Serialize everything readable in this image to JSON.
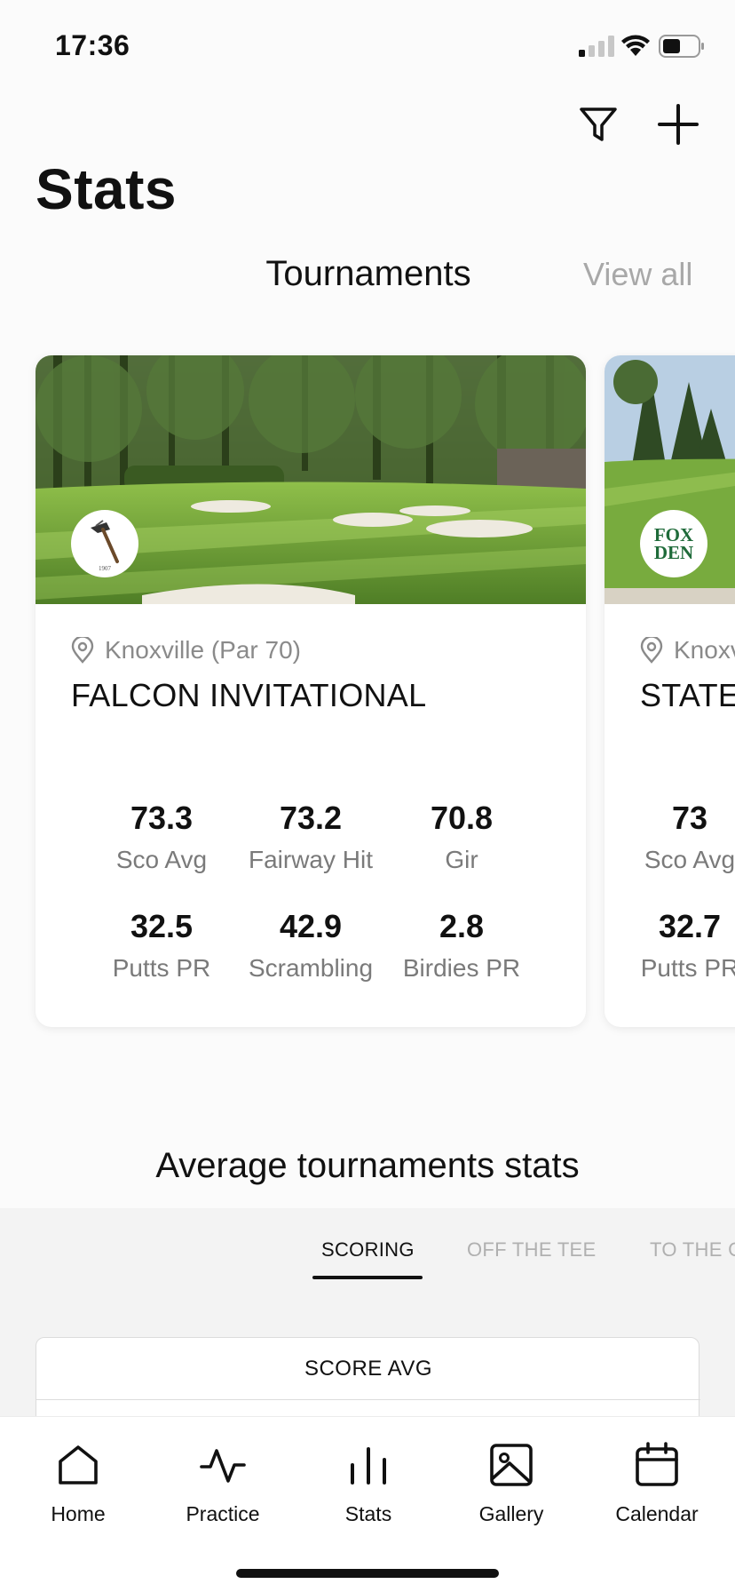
{
  "status_bar": {
    "time": "17:36"
  },
  "header": {
    "title": "Stats",
    "filter_icon": "filter-icon",
    "add_icon": "plus-icon"
  },
  "tournaments": {
    "section_title": "Tournaments",
    "view_all": "View all",
    "cards": [
      {
        "location": "Knoxville (Par 70)",
        "name": "FALCON INVITATIONAL",
        "stats": [
          {
            "value": "73.3",
            "label": "Sco Avg"
          },
          {
            "value": "73.2",
            "label": "Fairway Hit"
          },
          {
            "value": "70.8",
            "label": "Gir"
          },
          {
            "value": "32.5",
            "label": "Putts PR"
          },
          {
            "value": "42.9",
            "label": "Scrambling"
          },
          {
            "value": "2.8",
            "label": "Birdies PR"
          }
        ]
      },
      {
        "location": "Knoxv",
        "name": "STATE",
        "logo_text_1": "FOX",
        "logo_text_2": "DEN",
        "stats": [
          {
            "value": "73",
            "label": "Sco Avg"
          },
          {
            "value": "32.7",
            "label": "Putts PR"
          }
        ]
      }
    ]
  },
  "average": {
    "title": "Average tournaments stats",
    "tabs": [
      "SCORING",
      "OFF THE TEE",
      "TO THE G"
    ],
    "active_tab": "SCORING",
    "score_card_title": "SCORE AVG"
  },
  "bottom_nav": {
    "items": [
      {
        "label": "Home",
        "icon": "home-icon"
      },
      {
        "label": "Practice",
        "icon": "activity-icon"
      },
      {
        "label": "Stats",
        "icon": "bar-chart-icon"
      },
      {
        "label": "Gallery",
        "icon": "image-icon"
      },
      {
        "label": "Calendar",
        "icon": "calendar-icon"
      }
    ]
  },
  "colors": {
    "background": "#fbfbfb",
    "text": "#111111",
    "muted": "#8a8a8a",
    "fairway": "#6fa23a"
  }
}
